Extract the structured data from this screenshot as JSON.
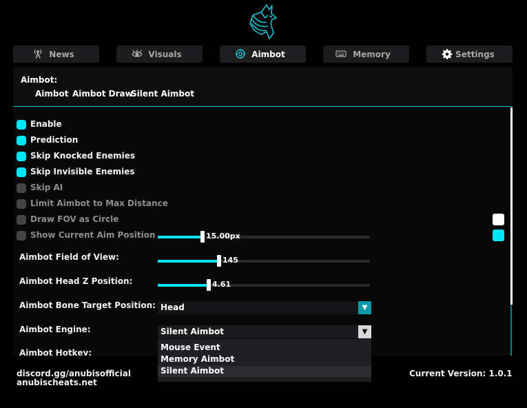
{
  "tabs": [
    {
      "label": "News",
      "icon": "antenna-icon"
    },
    {
      "label": "Visuals",
      "icon": "eye-icon"
    },
    {
      "label": "Aimbot",
      "icon": "crosshair-icon"
    },
    {
      "label": "Memory",
      "icon": "keyboard-icon"
    },
    {
      "label": "Settings",
      "icon": "gear-icon"
    }
  ],
  "active_tab": "Aimbot",
  "section": {
    "title": "Aimbot:",
    "subtabs": [
      "Aimbot",
      "Aimbot Draw",
      "Silent Aimbot"
    ]
  },
  "checkboxes": [
    {
      "label": "Enable",
      "checked": true
    },
    {
      "label": "Prediction",
      "checked": true
    },
    {
      "label": "Skip Knocked Enemies",
      "checked": true
    },
    {
      "label": "Skip Invisible Enemies",
      "checked": true
    },
    {
      "label": "Skip AI",
      "checked": false
    },
    {
      "label": "Limit Aimbot to Max Distance",
      "checked": false
    },
    {
      "label": "Draw FOV as Circle",
      "checked": false
    },
    {
      "label": "Show Current Aim Position",
      "checked": false
    }
  ],
  "sliders": [
    {
      "label": "",
      "value_text": "15.00px",
      "fraction": 0.21
    },
    {
      "label": "Aimbot Field of View:",
      "value_text": "145",
      "fraction": 0.29
    },
    {
      "label": "Aimbot Head Z Position:",
      "value_text": "4.61",
      "fraction": 0.24
    }
  ],
  "bone_target": {
    "label": "Aimbot Bone Target Position:",
    "value": "Head"
  },
  "engine": {
    "label": "Aimbot Engine:",
    "value": "Silent Aimbot",
    "options": [
      "Mouse Event",
      "Memory Aimbot",
      "Silent Aimbot"
    ]
  },
  "hotkey": {
    "label": "Aimbot Hotkey:"
  },
  "colors": {
    "accent": "#00e5f5",
    "swatch_1": "#ffffff",
    "swatch_2": "#00e5f5"
  },
  "footer": {
    "discord": "discord.gg/anubisofficial",
    "website": "anubischeats.net",
    "version": "Current Version: 1.0.1"
  }
}
